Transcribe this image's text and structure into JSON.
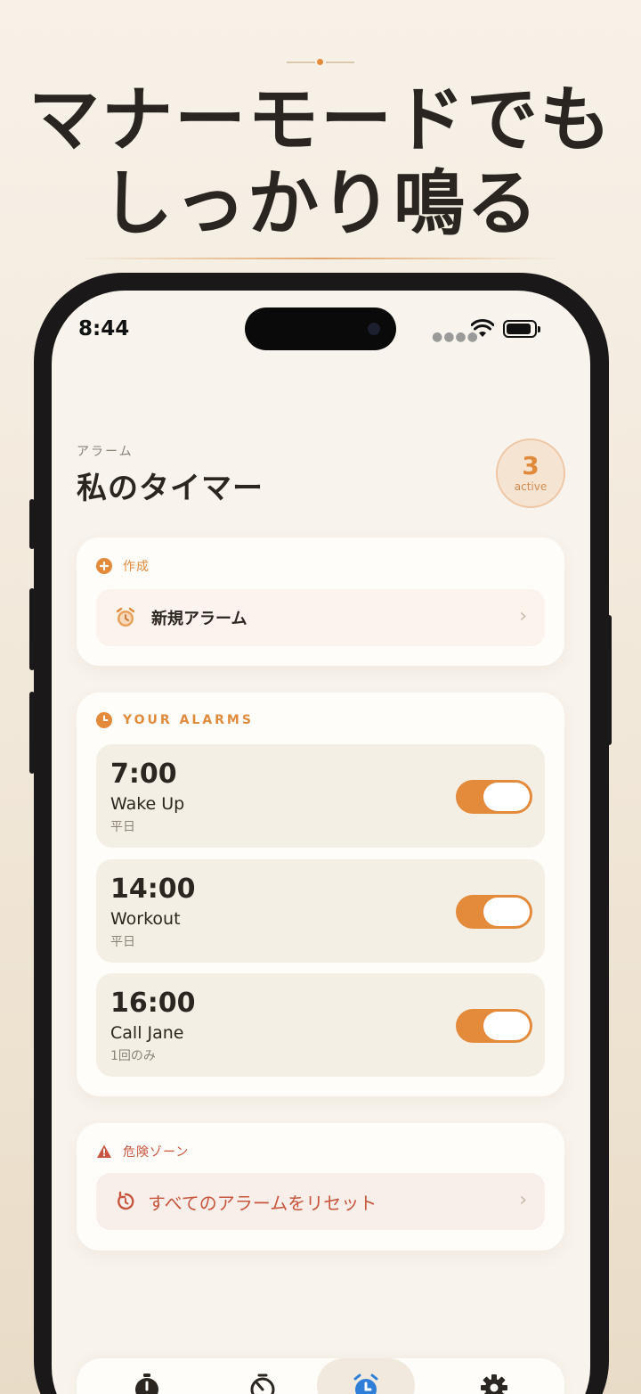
{
  "headline": {
    "line1": "マナーモードでも",
    "line2": "しっかり鳴る"
  },
  "status_bar": {
    "time": "8:44"
  },
  "header": {
    "section": "アラーム",
    "title": "私のタイマー",
    "active_count": "3",
    "active_label": "active"
  },
  "create_card": {
    "label": "作成",
    "new_alarm": "新規アラーム"
  },
  "alarms_card": {
    "label": "YOUR ALARMS",
    "alarms": [
      {
        "time": "7:00",
        "name": "Wake Up",
        "repeat": "平日",
        "enabled": true
      },
      {
        "time": "14:00",
        "name": "Workout",
        "repeat": "平日",
        "enabled": true
      },
      {
        "time": "16:00",
        "name": "Call Jane",
        "repeat": "1回のみ",
        "enabled": true
      }
    ]
  },
  "danger_card": {
    "label": "危険ゾーン",
    "reset": "すべてのアラームをリセット"
  },
  "tabs": [
    {
      "icon": "stopwatch-icon",
      "selected": false
    },
    {
      "icon": "timer-icon",
      "selected": false
    },
    {
      "icon": "alarm-clock-icon",
      "selected": true
    },
    {
      "icon": "gear-icon",
      "selected": false
    }
  ],
  "colors": {
    "accent": "#e38a3b",
    "danger": "#c8553d",
    "background": "#f8f3ec"
  }
}
